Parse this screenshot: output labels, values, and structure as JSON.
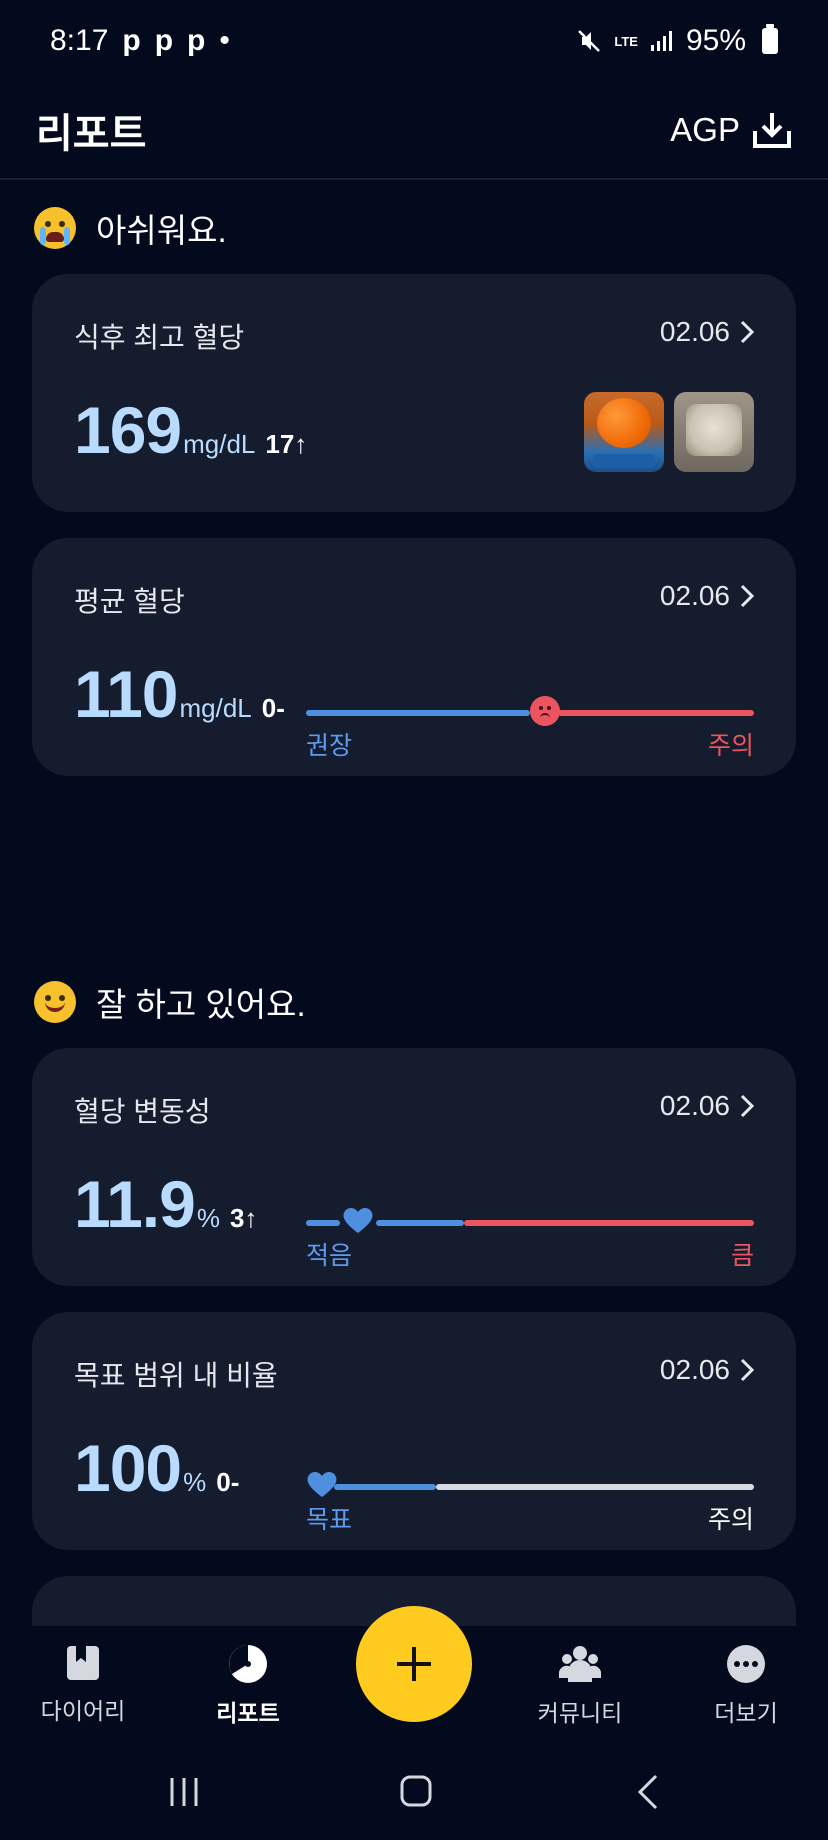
{
  "status_bar": {
    "time": "8:17",
    "notif_icons": [
      "p",
      "p",
      "p",
      "•"
    ],
    "network": "LTE",
    "battery": "95%"
  },
  "header": {
    "title": "리포트",
    "agp_label": "AGP"
  },
  "section_bad": {
    "title": "아쉬워요.",
    "icon": "crying-face-icon"
  },
  "section_good": {
    "title": "잘 하고 있어요.",
    "icon": "smiling-face-icon"
  },
  "cards": [
    {
      "label": "식후 최고 혈당",
      "date": "02.06",
      "value": "169",
      "unit": "mg/dL",
      "delta": "17↑",
      "photos": [
        "orange-photo",
        "milk-photo"
      ]
    },
    {
      "label": "평균 혈당",
      "date": "02.06",
      "value": "110",
      "unit": "mg/dL",
      "delta": "0-",
      "gauge": {
        "left_label": "권장",
        "right_label": "주의",
        "marker": "sad-face-icon",
        "colors": {
          "good": "#4f8fe0",
          "warn": "#ec5560"
        }
      }
    },
    {
      "label": "혈당 변동성",
      "date": "02.06",
      "value": "11.9",
      "unit": "%",
      "delta": "3↑",
      "gauge": {
        "left_label": "적음",
        "right_label": "큼",
        "marker": "heart-icon"
      }
    },
    {
      "label": "목표 범위 내 비율",
      "date": "02.06",
      "value": "100",
      "unit": "%",
      "delta": "0-",
      "gauge": {
        "left_label": "목표",
        "right_label": "주의",
        "marker": "heart-icon"
      }
    }
  ],
  "bottom_nav": {
    "items": [
      {
        "label": "다이어리",
        "icon": "diary-icon"
      },
      {
        "label": "리포트",
        "icon": "report-icon",
        "active": true
      },
      {
        "label": "커뮤니티",
        "icon": "community-icon"
      },
      {
        "label": "더보기",
        "icon": "more-icon"
      }
    ],
    "fab_icon": "plus-icon",
    "fab_color": "#ffcb1f"
  }
}
